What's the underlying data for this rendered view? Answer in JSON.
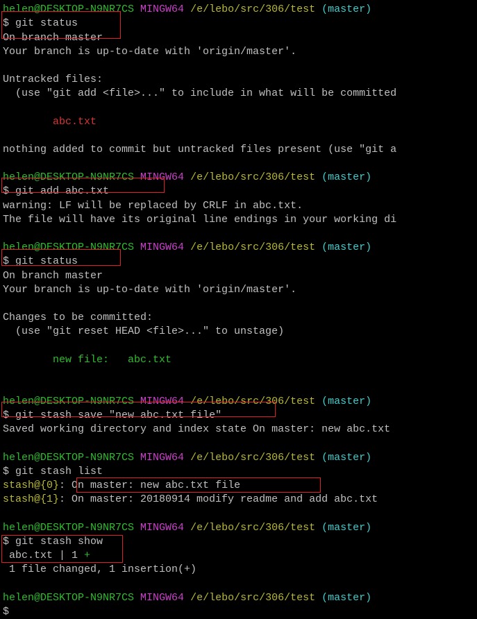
{
  "prompt": {
    "user_host": "helen@DESKTOP-N9NR7CS",
    "mingw": "MINGW64",
    "path": "/e/lebo/src/306/test",
    "branch": "(master)",
    "dollar": "$"
  },
  "blocks": {
    "b1_cmd": "git status",
    "b1_line1": "On branch master",
    "b1_line2": "Your branch is up-to-date with 'origin/master'.",
    "b1_line3": "Untracked files:",
    "b1_line4": "  (use \"git add <file>...\" to include in what will be committed",
    "b1_file": "        abc.txt",
    "b1_line5": "nothing added to commit but untracked files present (use \"git a",
    "b2_cmd": "git add abc.txt",
    "b2_line1": "warning: LF will be replaced by CRLF in abc.txt.",
    "b2_line2": "The file will have its original line endings in your working di",
    "b3_cmd": "git status",
    "b3_line1": "On branch master",
    "b3_line2": "Your branch is up-to-date with 'origin/master'.",
    "b3_line3": "Changes to be committed:",
    "b3_line4": "  (use \"git reset HEAD <file>...\" to unstage)",
    "b3_file": "        new file:   abc.txt",
    "b4_cmd": "git stash save \"new abc.txt file\"",
    "b4_line1": "Saved working directory and index state On master: new abc.txt",
    "b5_cmd": "git stash list",
    "b5_s0a": "stash@{0}",
    "b5_s0b": ": ",
    "b5_s0c": "On master: new abc.txt file",
    "b5_s1a": "stash@{1}",
    "b5_s1b": ": On master: 20180914 modify readme and add abc.txt",
    "b6_cmd": "git stash show",
    "b6_l1a": " abc.txt | 1 ",
    "b6_l1b": "+",
    "b6_l2": " 1 file changed, 1 insertion(+)"
  }
}
